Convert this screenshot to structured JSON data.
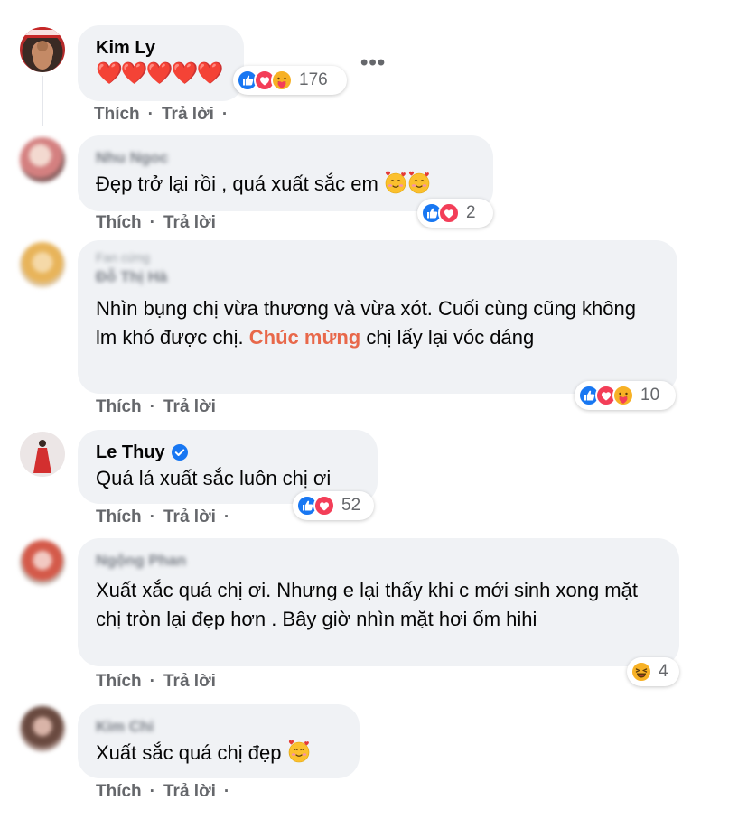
{
  "actions": {
    "like": "Thích",
    "reply": "Trả lời",
    "separator": "·"
  },
  "comments": [
    {
      "name": "Kim Ly",
      "text": "❤️❤️❤️❤️❤️",
      "reaction_count": "176"
    },
    {
      "name": "Nhu Ngoc",
      "text": "Đẹp trở lại rồi , quá xuất sắc em",
      "reaction_count": "2"
    },
    {
      "badge": "Fan cứng",
      "name": "Đỗ Thị Hà",
      "text_before": "Nhìn bụng chị vừa thương và vừa xót. Cuối cùng cũng không lm khó được chị. ",
      "highlight": "Chúc mừng",
      "text_after": " chị lấy lại vóc dáng",
      "reaction_count": "10"
    },
    {
      "name": "Le Thuy",
      "text": "Quá lá xuất sắc luôn chị ơi",
      "reaction_count": "52"
    },
    {
      "name": "Ngộng Phan",
      "text": "Xuất xắc quá chị ơi. Nhưng e lại thấy khi c mới sinh xong mặt chị tròn lại đẹp hơn . Bây giờ nhìn mặt hơi ốm hihi",
      "reaction_count": "4"
    },
    {
      "name": "Kim Chi",
      "text": "Xuất sắc quá chị đẹp",
      "reaction_count": ""
    }
  ],
  "more_options": "•••",
  "icons": [
    "like-icon",
    "love-icon",
    "care-icon",
    "haha-icon",
    "heart-eyes-emoji",
    "verified-icon",
    "more-options-icon"
  ],
  "colors": {
    "bubble": "#f0f2f5",
    "like_blue": "#1877f2",
    "love_red": "#f33e58",
    "highlight": "#e8684a",
    "meta_gray": "#65676b"
  }
}
